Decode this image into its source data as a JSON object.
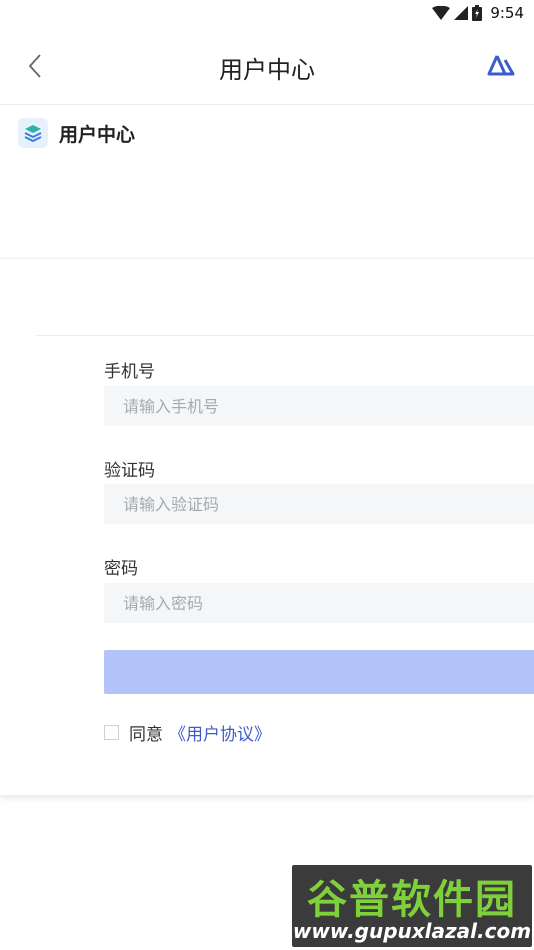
{
  "status_bar": {
    "time": "9:54",
    "icons": [
      "wifi-icon",
      "signal-icon",
      "battery-icon"
    ]
  },
  "header": {
    "title": "用户中心",
    "back_icon": "chevron-left-icon",
    "logo_icon": "app-logo-icon"
  },
  "section": {
    "title": "用户中心",
    "icon": "layers-icon"
  },
  "form": {
    "phone": {
      "label": "手机号",
      "placeholder": "请输入手机号"
    },
    "code": {
      "label": "验证码",
      "placeholder": "请输入验证码"
    },
    "password": {
      "label": "密码",
      "placeholder": "请输入密码"
    },
    "submit_label": "",
    "agree_text": "同意",
    "agree_link": "《用户协议》",
    "agree_checked": false
  },
  "watermark": {
    "title": "谷普软件园",
    "url": "www.gupuxlazal.com"
  },
  "colors": {
    "accent": "#3b5ccf",
    "submit_bg": "#b3c4fb",
    "input_bg": "#f5f6f8"
  }
}
